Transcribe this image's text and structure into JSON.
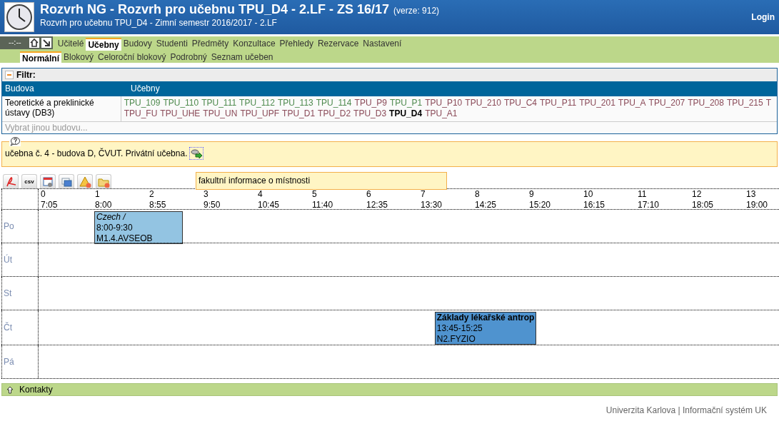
{
  "header": {
    "title": "Rozvrh NG - Rozvrh pro učebnu TPU_D4 - 2.LF - ZS 16/17",
    "version": "(verze: 912)",
    "subtitle": "Rozvrh pro učebnu TPU_D4 - Zimní semestr 2016/2017 - 2.LF",
    "login": "Login"
  },
  "clock": "--:--",
  "menu": [
    {
      "label": "Učitelé",
      "selected": false
    },
    {
      "label": "Učebny",
      "selected": true
    },
    {
      "label": "Budovy",
      "selected": false
    },
    {
      "label": "Studenti",
      "selected": false
    },
    {
      "label": "Předměty",
      "selected": false
    },
    {
      "label": "Konzultace",
      "selected": false
    },
    {
      "label": "Přehledy",
      "selected": false
    },
    {
      "label": "Rezervace",
      "selected": false
    },
    {
      "label": "Nastavení",
      "selected": false
    }
  ],
  "submenu": [
    {
      "label": "Normální",
      "selected": true
    },
    {
      "label": "Blokový",
      "selected": false
    },
    {
      "label": "Celoroční blokový",
      "selected": false
    },
    {
      "label": "Podrobný",
      "selected": false
    },
    {
      "label": "Seznam učeben",
      "selected": false
    }
  ],
  "filter": {
    "title": "Filtr:",
    "columns": [
      "Budova",
      "Učebny"
    ],
    "building": "Teoretické a preklinické ústavy (DB3)",
    "other_building": "Vybrat jinou budovu...",
    "rooms": [
      {
        "label": "TPU_109",
        "color": "#4e8a4e",
        "selected": false
      },
      {
        "label": "TPU_110",
        "color": "#4e8a4e",
        "selected": false
      },
      {
        "label": "TPU_111",
        "color": "#4e8a4e",
        "selected": false
      },
      {
        "label": "TPU_112",
        "color": "#4e8a4e",
        "selected": false
      },
      {
        "label": "TPU_113",
        "color": "#4e8a4e",
        "selected": false
      },
      {
        "label": "TPU_114",
        "color": "#4e8a4e",
        "selected": false
      },
      {
        "label": "TPU_P9",
        "color": "#8a4a58",
        "selected": false
      },
      {
        "label": "TPU_P1",
        "color": "#4e8a4e",
        "selected": false
      },
      {
        "label": "TPU_P10",
        "color": "#8a4a58",
        "selected": false
      },
      {
        "label": "TPU_210",
        "color": "#8a4a58",
        "selected": false
      },
      {
        "label": "TPU_C4",
        "color": "#8a4a58",
        "selected": false
      },
      {
        "label": "TPU_P11",
        "color": "#8a4a58",
        "selected": false
      },
      {
        "label": "TPU_201",
        "color": "#8a4a58",
        "selected": false
      },
      {
        "label": "TPU_A",
        "color": "#8a4a58",
        "selected": false
      },
      {
        "label": "TPU_207",
        "color": "#8a4a58",
        "selected": false
      },
      {
        "label": "TPU_208",
        "color": "#8a4a58",
        "selected": false
      },
      {
        "label": "TPU_215",
        "color": "#8a4a58",
        "selected": false
      },
      {
        "label": "T",
        "color": "#8a4a58",
        "selected": false
      },
      {
        "label": "TPU_FU",
        "color": "#8a4a58",
        "selected": false
      },
      {
        "label": "TPU_UHE",
        "color": "#8a4a58",
        "selected": false
      },
      {
        "label": "TPU_UN",
        "color": "#8a4a58",
        "selected": false
      },
      {
        "label": "TPU_UPF",
        "color": "#8a4a58",
        "selected": false
      },
      {
        "label": "TPU_D1",
        "color": "#8a4a58",
        "selected": false
      },
      {
        "label": "TPU_D2",
        "color": "#8a4a58",
        "selected": false
      },
      {
        "label": "TPU_D3",
        "color": "#8a4a58",
        "selected": false
      },
      {
        "label": "TPU_D4",
        "selected": true
      },
      {
        "label": "TPU_A1",
        "color": "#8a4a58",
        "selected": false
      }
    ]
  },
  "room_info": {
    "text": "učebna č. 4 - budova D, ČVUT. Privátní učebna.",
    "tooltip": "fakultní informace o místnosti"
  },
  "toolbar": [
    {
      "kind": "pdf"
    },
    {
      "kind": "csv",
      "label": "csv"
    },
    {
      "kind": "calendar"
    },
    {
      "kind": "windows"
    },
    {
      "kind": "warning"
    },
    {
      "kind": "folder"
    }
  ],
  "timetable": {
    "slots": [
      {
        "number": "0",
        "time": "7:05"
      },
      {
        "number": "1",
        "time": "8:00"
      },
      {
        "number": "2",
        "time": "8:55"
      },
      {
        "number": "3",
        "time": "9:50"
      },
      {
        "number": "4",
        "time": "10:45"
      },
      {
        "number": "5",
        "time": "11:40"
      },
      {
        "number": "6",
        "time": "12:35"
      },
      {
        "number": "7",
        "time": "13:30"
      },
      {
        "number": "8",
        "time": "14:25"
      },
      {
        "number": "9",
        "time": "15:20"
      },
      {
        "number": "10",
        "time": "16:15"
      },
      {
        "number": "11",
        "time": "17:10"
      },
      {
        "number": "12",
        "time": "18:05"
      },
      {
        "number": "13",
        "time": "19:00"
      }
    ],
    "days": [
      {
        "label": "Po",
        "events": [
          {
            "kind": "exercise",
            "title": "Czech /",
            "time": "8:00-9:30",
            "room": "M1.4.AVSEOB"
          }
        ]
      },
      {
        "label": "Út"
      },
      {
        "label": "St"
      },
      {
        "label": "Čt",
        "events": [
          {
            "kind": "lecture",
            "title": "Základy lékařské antrop",
            "time": "13:45-15:25",
            "room": "N2.FYZIO"
          }
        ]
      },
      {
        "label": "Pá"
      }
    ]
  },
  "contacts": "Kontakty",
  "footer": "Univerzita Karlova | Informační systém UK"
}
